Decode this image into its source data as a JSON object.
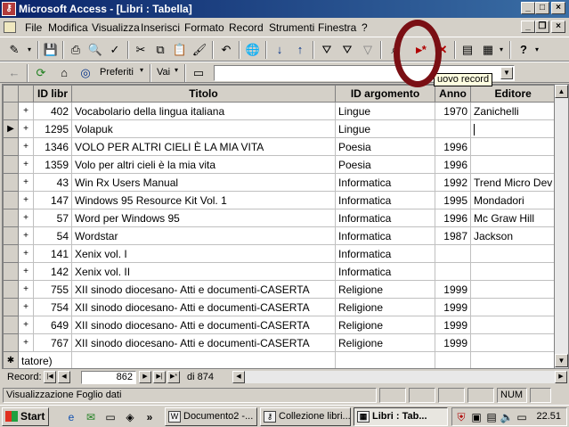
{
  "window": {
    "title": "Microsoft Access - [Libri : Tabella]",
    "app_icon": "access-key-icon"
  },
  "menu": {
    "items": [
      "File",
      "Modifica",
      "Visualizza",
      "Inserisci",
      "Formato",
      "Record",
      "Strumenti",
      "Finestra",
      "?"
    ]
  },
  "toolbar2": {
    "favorites_label": "Preferiti",
    "go_label": "Vai",
    "address_value": ""
  },
  "tooltip": "uovo record",
  "grid": {
    "columns": [
      "ID libr",
      "Titolo",
      "ID argomento",
      "Anno",
      "Editore"
    ],
    "rows": [
      {
        "id": "402",
        "titolo": "Vocabolario della lingua italiana",
        "argomento": "Lingue",
        "anno": "1970",
        "editore": "Zanichelli"
      },
      {
        "id": "1295",
        "titolo": "Volapuk",
        "argomento": "Lingue",
        "anno": "",
        "editore": ""
      },
      {
        "id": "1346",
        "titolo": "VOLO PER ALTRI CIELI È LA MIA VITA",
        "argomento": "Poesia",
        "anno": "1996",
        "editore": ""
      },
      {
        "id": "1359",
        "titolo": "Volo per altri cieli è la mia vita",
        "argomento": "Poesia",
        "anno": "1996",
        "editore": ""
      },
      {
        "id": "43",
        "titolo": "Win Rx Users Manual",
        "argomento": "Informatica",
        "anno": "1992",
        "editore": "Trend Micro Dev"
      },
      {
        "id": "147",
        "titolo": "Windows 95 Resource Kit Vol. 1",
        "argomento": "Informatica",
        "anno": "1995",
        "editore": "Mondadori"
      },
      {
        "id": "57",
        "titolo": "Word per Windows 95",
        "argomento": "Informatica",
        "anno": "1996",
        "editore": "Mc Graw Hill"
      },
      {
        "id": "54",
        "titolo": "Wordstar",
        "argomento": "Informatica",
        "anno": "1987",
        "editore": "Jackson"
      },
      {
        "id": "141",
        "titolo": "Xenix vol. I",
        "argomento": "Informatica",
        "anno": "",
        "editore": ""
      },
      {
        "id": "142",
        "titolo": "Xenix vol. II",
        "argomento": "Informatica",
        "anno": "",
        "editore": ""
      },
      {
        "id": "755",
        "titolo": "XII sinodo diocesano- Atti e documenti-CASERTA",
        "argomento": "Religione",
        "anno": "1999",
        "editore": ""
      },
      {
        "id": "754",
        "titolo": "XII sinodo diocesano- Atti e documenti-CASERTA",
        "argomento": "Religione",
        "anno": "1999",
        "editore": ""
      },
      {
        "id": "649",
        "titolo": "XII sinodo diocesano- Atti e documenti-CASERTA",
        "argomento": "Religione",
        "anno": "1999",
        "editore": ""
      },
      {
        "id": "767",
        "titolo": "XII sinodo diocesano- Atti e documenti-CASERTA",
        "argomento": "Religione",
        "anno": "1999",
        "editore": ""
      }
    ],
    "new_row_id": "tatore)",
    "current_row_index": 1
  },
  "navigation": {
    "label": "Record:",
    "current": "862",
    "total": "di 874"
  },
  "status": {
    "text": "Visualizzazione Foglio dati",
    "num": "NUM"
  },
  "taskbar": {
    "start": "Start",
    "tasks": [
      "Documento2 -...",
      "Collezione libri...",
      "Libri : Tab..."
    ],
    "clock": "22.51"
  }
}
